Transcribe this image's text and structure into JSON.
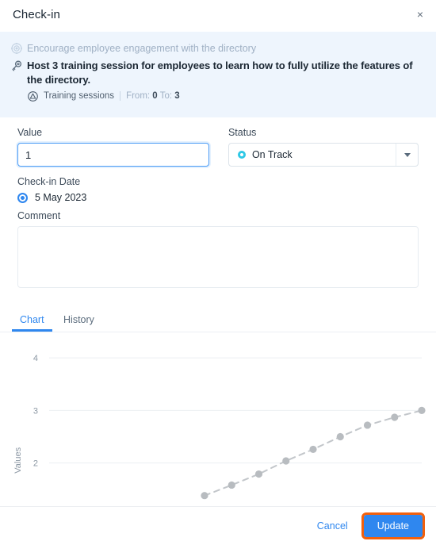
{
  "dialog": {
    "title": "Check-in",
    "close_label": "×",
    "close_icon": "close-icon"
  },
  "banner": {
    "objective_icon": "target-icon",
    "objective_text": "Encourage employee engagement with the directory",
    "key_result_icon": "key-icon",
    "key_result_text": "Host 3 training session for employees to learn how to fully utilize the features of the directory.",
    "metric_icon": "metric-triangle-icon",
    "metric_name": "Training sessions",
    "range_from_label": "From:",
    "range_from_value": "0",
    "range_to_label": "To:",
    "range_to_value": "3"
  },
  "form": {
    "value_label": "Value",
    "value_input": "1",
    "value_placeholder": "",
    "status_label": "Status",
    "status_selected": "On Track",
    "status_color": "#2ec8e6",
    "status_options": [
      "On Track"
    ],
    "checkin_date_label": "Check-in Date",
    "checkin_date_value": "5 May 2023",
    "comment_label": "Comment",
    "comment_value": "",
    "comment_placeholder": ""
  },
  "tabs": {
    "items": [
      {
        "label": "Chart",
        "active": true
      },
      {
        "label": "History",
        "active": false
      }
    ],
    "active_color": "#2f87ef"
  },
  "footer": {
    "cancel_label": "Cancel",
    "update_label": "Update",
    "update_bg": "#2f87ef",
    "update_focus_ring": "#f2600c"
  },
  "chart_data": {
    "type": "line",
    "title": "",
    "xlabel": "",
    "ylabel": "Values",
    "ytick_labels": [
      "4",
      "3",
      "2"
    ],
    "ytick_values": [
      4,
      3,
      2
    ],
    "ylim": [
      1.3,
      4.35
    ],
    "grid": true,
    "legend": false,
    "line_style": "dashed",
    "line_color": "#c2c6ca",
    "marker_color": "#b8bcc0",
    "x": [
      0,
      1,
      2,
      3,
      4,
      5,
      6,
      7,
      8
    ],
    "values": [
      1.38,
      1.58,
      1.79,
      2.04,
      2.26,
      2.5,
      2.72,
      2.87,
      3.0
    ],
    "series": [
      {
        "name": "Values",
        "values": [
          1.38,
          1.58,
          1.79,
          2.04,
          2.26,
          2.5,
          2.72,
          2.87,
          3.0
        ]
      }
    ]
  }
}
